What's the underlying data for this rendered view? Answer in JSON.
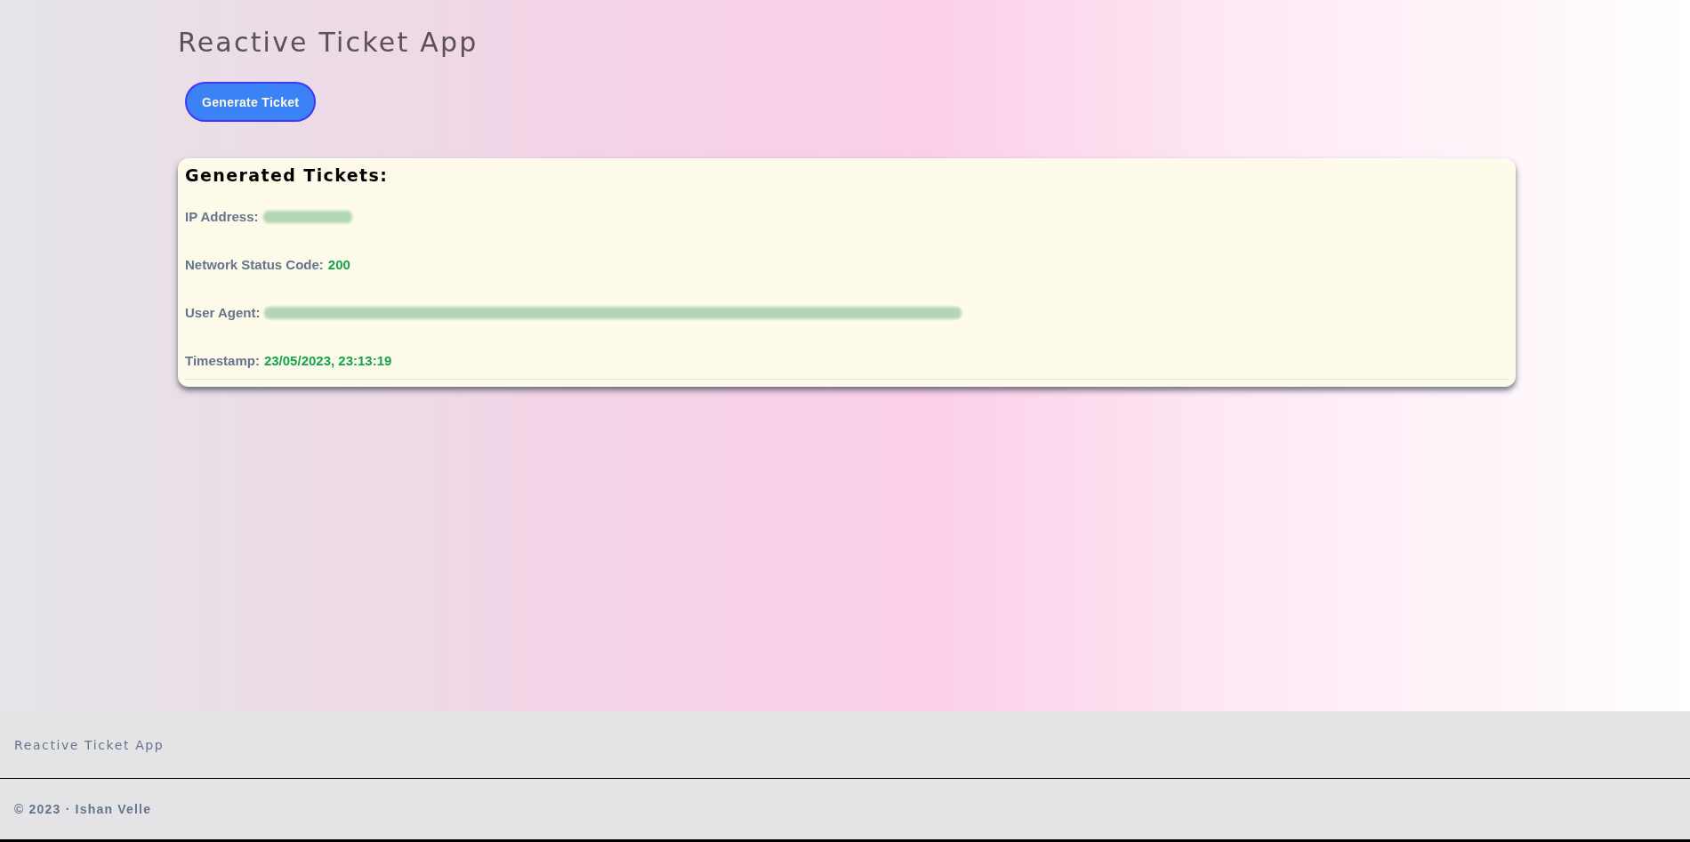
{
  "header": {
    "title": "Reactive Ticket App",
    "button": {
      "label": "Generate Ticket"
    }
  },
  "tickets": {
    "heading": "Generated Tickets:",
    "ip_address": {
      "label": "IP Address:",
      "redacted": true
    },
    "status_code": {
      "label": "Network Status Code:",
      "value": "200"
    },
    "user_agent": {
      "label": "User Agent:",
      "redacted": true
    },
    "timestamp": {
      "label": "Timestamp:",
      "value": "23/05/2023, 23:13:19"
    }
  },
  "footer": {
    "brand": "Reactive Ticket App",
    "copyright": "© 2023 · Ishan Velle"
  }
}
